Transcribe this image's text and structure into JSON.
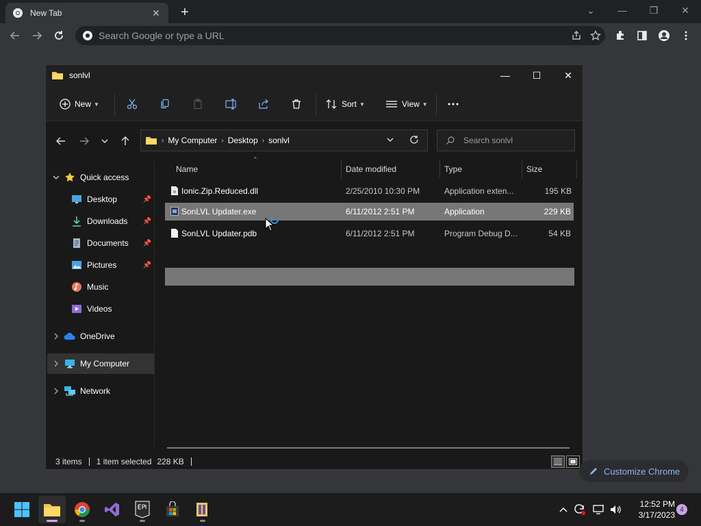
{
  "browser": {
    "tab_title": "New Tab",
    "omnibox_placeholder": "Search Google or type a URL",
    "customize_label": "Customize Chrome",
    "badge_count": "4"
  },
  "explorer": {
    "window_title": "sonlvl",
    "toolbar": {
      "new_label": "New",
      "sort_label": "Sort",
      "view_label": "View"
    },
    "breadcrumb": [
      "My Computer",
      "Desktop",
      "sonlvl"
    ],
    "search_placeholder": "Search sonlvl",
    "nav": {
      "quick_access": "Quick access",
      "desktop": "Desktop",
      "downloads": "Downloads",
      "documents": "Documents",
      "pictures": "Pictures",
      "music": "Music",
      "videos": "Videos",
      "onedrive": "OneDrive",
      "my_computer": "My Computer",
      "network": "Network"
    },
    "columns": {
      "name": "Name",
      "date": "Date modified",
      "type": "Type",
      "size": "Size"
    },
    "files": [
      {
        "name": "Ionic.Zip.Reduced.dll",
        "date": "2/25/2010 10:30 PM",
        "type": "Application exten...",
        "size": "195 KB"
      },
      {
        "name": "SonLVL Updater.exe",
        "date": "6/11/2012 2:51 PM",
        "type": "Application",
        "size": "229 KB"
      },
      {
        "name": "SonLVL Updater.pdb",
        "date": "6/11/2012 2:51 PM",
        "type": "Program Debug D...",
        "size": "54 KB"
      }
    ],
    "status": {
      "items": "3 items",
      "selected": "1 item selected",
      "size": "228 KB"
    }
  },
  "taskbar": {
    "time": "12:52 PM",
    "date": "3/17/2023"
  }
}
